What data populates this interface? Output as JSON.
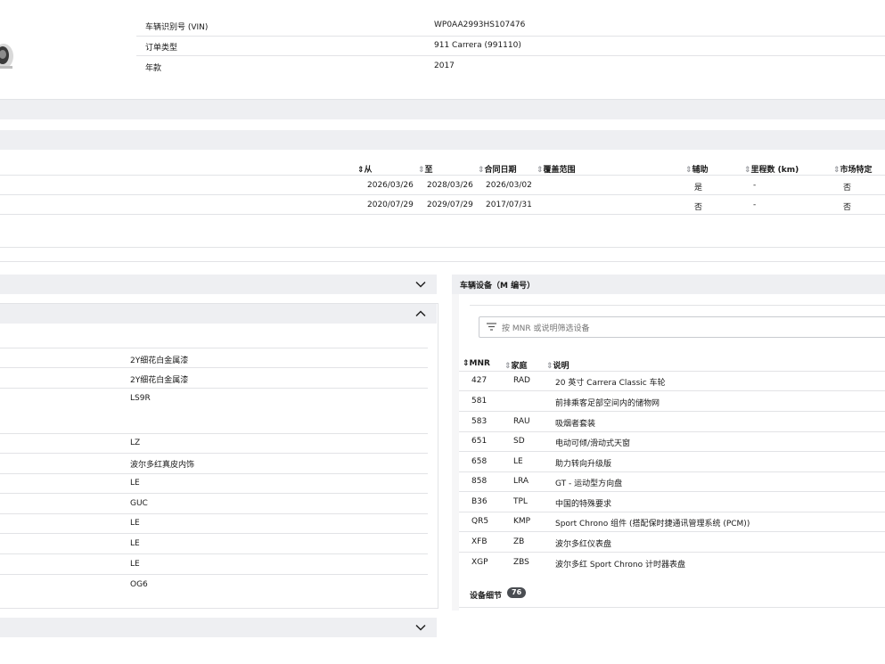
{
  "vehicle_info": {
    "rows": [
      {
        "label": "车辆识别号 (VIN)",
        "value": "WP0AA2993HS107476"
      },
      {
        "label": "订单类型",
        "value": "911 Carrera (991110)"
      },
      {
        "label": "年款",
        "value": "2017"
      }
    ]
  },
  "warranty_table": {
    "headers": {
      "from": "从",
      "to": "至",
      "contract_date": "合同日期",
      "coverage": "覆盖范围",
      "auxiliary": "辅助",
      "mileage": "里程数 (km)",
      "market_specific": "市场特定"
    },
    "rows": [
      {
        "from": "2026/03/26",
        "to": "2028/03/26",
        "contract_date": "2026/03/02",
        "coverage": "",
        "auxiliary": "是",
        "mileage": "-",
        "market_specific": "否"
      },
      {
        "from": "2020/07/29",
        "to": "2029/07/29",
        "contract_date": "2017/07/31",
        "coverage": "",
        "auxiliary": "否",
        "mileage": "-",
        "market_specific": "否"
      }
    ]
  },
  "left_panel": {
    "values": [
      "2Y细花白金属漆",
      "2Y细花白金属漆",
      "LS9R",
      "LZ",
      "波尔多红真皮内饰",
      "LE",
      "GUC",
      "LE",
      "LE",
      "LE",
      "OG6"
    ]
  },
  "equipment": {
    "title": "车辆设备（M 编号）",
    "filter_placeholder": "按 MNR 或说明筛选设备",
    "headers": {
      "mnr": "MNR",
      "family": "家庭",
      "description": "说明"
    },
    "rows": [
      {
        "mnr": "427",
        "family": "RAD",
        "description": "20 英寸 Carrera Classic 车轮"
      },
      {
        "mnr": "581",
        "family": "",
        "description": "前排乘客足部空间内的储物网"
      },
      {
        "mnr": "583",
        "family": "RAU",
        "description": "吸烟者套装"
      },
      {
        "mnr": "651",
        "family": "SD",
        "description": "电动可倾/滑动式天窗"
      },
      {
        "mnr": "658",
        "family": "LE",
        "description": "助力转向升级版"
      },
      {
        "mnr": "858",
        "family": "LRA",
        "description": "GT - 运动型方向盘"
      },
      {
        "mnr": "B36",
        "family": "TPL",
        "description": "中国的特殊要求"
      },
      {
        "mnr": "QR5",
        "family": "KMP",
        "description": "Sport Chrono 组件 (搭配保时捷通讯管理系统 (PCM))"
      },
      {
        "mnr": "XFB",
        "family": "ZB",
        "description": "波尔多红仪表盘"
      },
      {
        "mnr": "XGP",
        "family": "ZBS",
        "description": "波尔多红 Sport Chrono 计时器表盘"
      }
    ],
    "details_label": "设备细节",
    "details_count": "76"
  },
  "colors": {
    "band": "#eeeff2",
    "divider": "#e2e3e6",
    "badge": "#4a4d52"
  }
}
